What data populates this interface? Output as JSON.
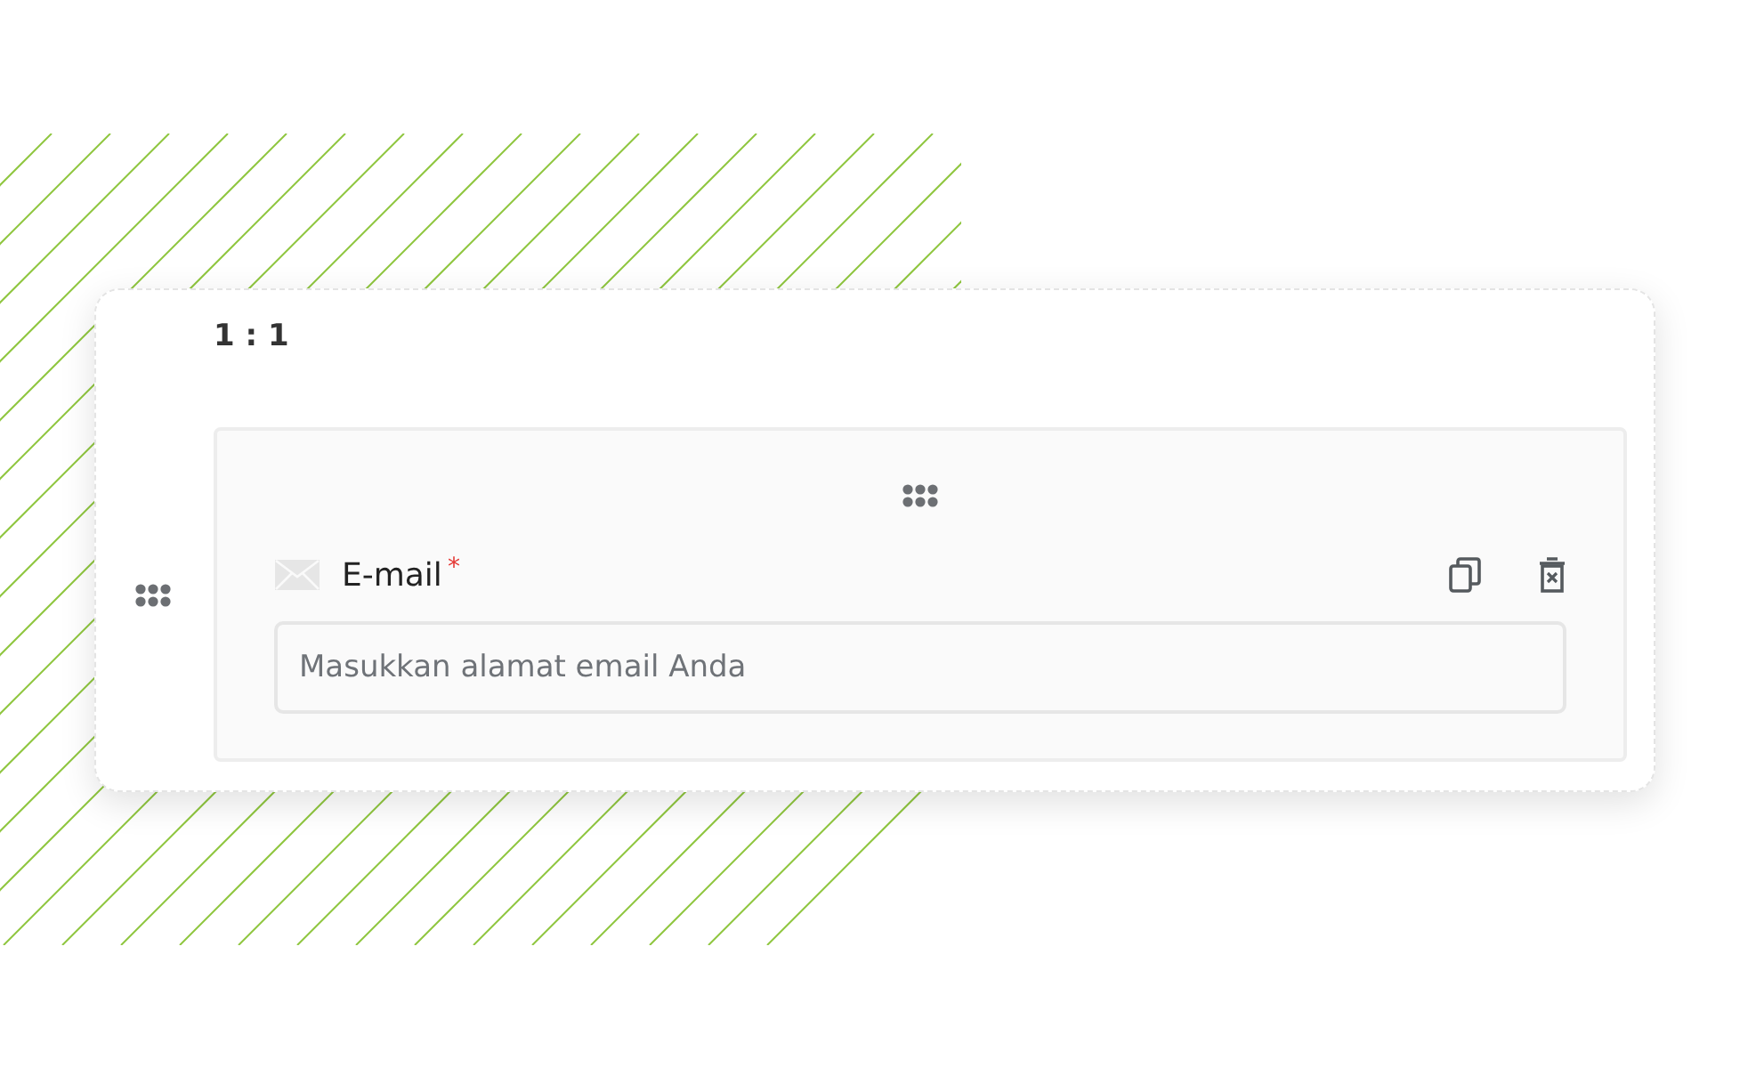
{
  "layout": {
    "ratio": "1 : 1"
  },
  "field": {
    "label": "E-mail",
    "required_mark": "*",
    "placeholder": "Masukkan alamat email Anda"
  }
}
